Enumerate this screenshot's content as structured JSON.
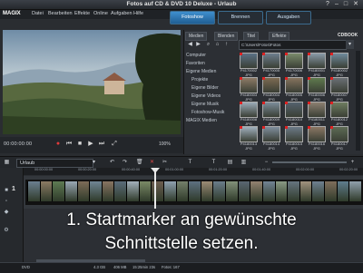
{
  "window": {
    "title": "Fotos auf CD & DVD 10 Deluxe - Urlaub",
    "controls": [
      "?",
      "–",
      "□",
      "✕"
    ]
  },
  "menu": {
    "logo": "MAGIX",
    "items": [
      "Datei",
      "Bearbeiten",
      "Effekte",
      "Online",
      "Aufgaben",
      "Hilfe"
    ]
  },
  "modes": {
    "edit": "Fotoshow",
    "burn": "Brennen",
    "output": "Ausgaben"
  },
  "preview": {
    "timecode": "00:00:00:00",
    "zoom": "100%"
  },
  "pool": {
    "tabs": [
      "Medien",
      "Blenden",
      "Titel",
      "Effekte"
    ],
    "brand": "CDBOOK",
    "path": "C:\\Users\\Fotos\\Fotos",
    "folders": [
      "Computer",
      "Favoriten",
      "Eigene Medien",
      "Projekte",
      "Eigene Bilder",
      "Eigene Videos",
      "Eigene Musik",
      "Fotoshow-Musik",
      "MAGIX Medien"
    ],
    "thumbs": [
      {
        "label": "P4170002\nJPG",
        "color": "#5b7186"
      },
      {
        "label": "P4170005\nJPG",
        "color": "#6d7e8e"
      },
      {
        "label": "P4170006\nJPG",
        "color": "#7a8b6b"
      },
      {
        "label": "P4180001\nJPG",
        "color": "#8a9aa8"
      },
      {
        "label": "P4180002\nJPG",
        "color": "#6f8a9c"
      },
      {
        "label": "P4180003\nJPG",
        "color": "#8d7a66"
      },
      {
        "label": "P4180004\nJPG",
        "color": "#7d6a52"
      },
      {
        "label": "P4180005\nJPG",
        "color": "#86735e"
      },
      {
        "label": "P4180006\nJPG",
        "color": "#5f7a4e"
      },
      {
        "label": "P4180007\nJPG",
        "color": "#6a6f75"
      },
      {
        "label": "P4180008\nJPG",
        "color": "#9aa9b6"
      },
      {
        "label": "P4180009\nJPG",
        "color": "#7b8c99"
      },
      {
        "label": "P4180010\nJPG",
        "color": "#55626e"
      },
      {
        "label": "P4180011\nJPG",
        "color": "#8c7f70"
      },
      {
        "label": "P4180012\nJPG",
        "color": "#6e7d60"
      },
      {
        "label": "P4180013\nJPG",
        "color": "#a0b0bd"
      },
      {
        "label": "P4180014\nJPG",
        "color": "#7f8f9d"
      },
      {
        "label": "P4180015\nJPG",
        "color": "#6c7a88"
      },
      {
        "label": "P4180016\nJPG",
        "color": "#8b7764"
      },
      {
        "label": "P4180017\nJPG",
        "color": "#5d6b55"
      }
    ]
  },
  "timeline": {
    "project": "Urlaub",
    "track_number": "1",
    "ruler": [
      "00:00:00:00",
      "00:00:20:00",
      "00:00:40:00",
      "00:01:00:00",
      "00:01:20:00",
      "00:01:40:00",
      "00:02:00:00",
      "00:02:20:00"
    ],
    "clip_colors": [
      "#6b7f90",
      "#8c7a63",
      "#5e7a53",
      "#9aa8b4",
      "#7d6c58",
      "#6f8594",
      "#887462",
      "#5b6c7a",
      "#a3b0ba",
      "#7a8a66",
      "#6c5d4f",
      "#8fa1af",
      "#74806a",
      "#5e7081",
      "#9c8b75",
      "#6a7c8b",
      "#82917a",
      "#5a6672",
      "#938270",
      "#718394",
      "#8a9a84",
      "#66747f",
      "#a1927e",
      "#6e8090",
      "#7f6e5c",
      "#5f7d8e",
      "#90a0ac"
    ]
  },
  "caption": {
    "line1": "1. Startmarker an gewünschte",
    "line2": "Schnittstelle setzen."
  },
  "status": {
    "left": "DVD",
    "size": "4.3 GB",
    "dur": "406 MB",
    "time": "15:25min 23s",
    "fotos": "Fotos: 167"
  }
}
